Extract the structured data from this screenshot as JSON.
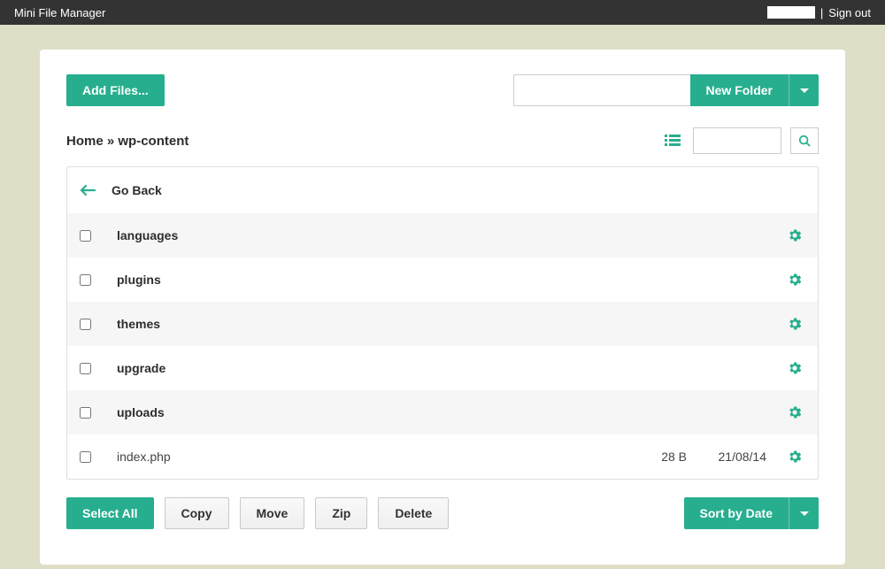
{
  "app_title": "Mini File Manager",
  "topbar": {
    "signout": "Sign out",
    "separator": "|"
  },
  "toolbar": {
    "add_files": "Add Files...",
    "new_folder": "New Folder"
  },
  "breadcrumb": {
    "home": "Home",
    "sep": "»",
    "current": "wp-content"
  },
  "goback": "Go Back",
  "rows": [
    {
      "name": "languages",
      "type": "folder",
      "size": "",
      "date": ""
    },
    {
      "name": "plugins",
      "type": "folder",
      "size": "",
      "date": ""
    },
    {
      "name": "themes",
      "type": "folder",
      "size": "",
      "date": ""
    },
    {
      "name": "upgrade",
      "type": "folder",
      "size": "",
      "date": ""
    },
    {
      "name": "uploads",
      "type": "folder",
      "size": "",
      "date": ""
    },
    {
      "name": "index.php",
      "type": "file",
      "size": "28 B",
      "date": "21/08/14"
    }
  ],
  "actions": {
    "select_all": "Select All",
    "copy": "Copy",
    "move": "Move",
    "zip": "Zip",
    "delete": "Delete",
    "sort": "Sort by Date"
  },
  "colors": {
    "accent": "#27ae8e",
    "background": "#dfdfc8"
  }
}
